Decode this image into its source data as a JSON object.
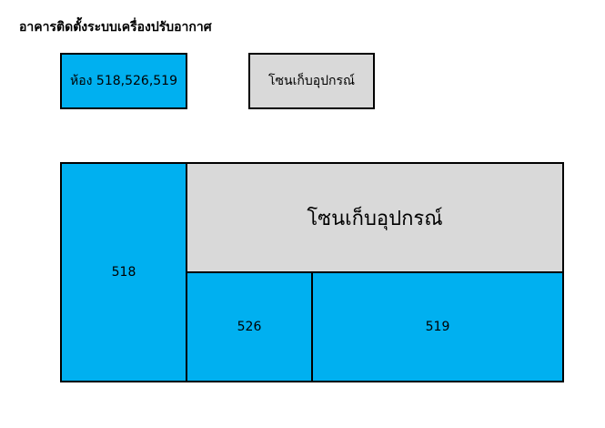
{
  "title": "อาคารติดตั้งระบบเครื่องปรับอากาศ",
  "legend": {
    "rooms_label": "ห้อง 518,526,519",
    "storage_label": "โซนเก็บอุปกรณ์"
  },
  "plan": {
    "room_518": "518",
    "room_526": "526",
    "room_519": "519",
    "storage_zone": "โซนเก็บอุปกรณ์"
  },
  "colors": {
    "room_fill": "#00b0f0",
    "storage_fill": "#d9d9d9",
    "border": "#000000"
  }
}
